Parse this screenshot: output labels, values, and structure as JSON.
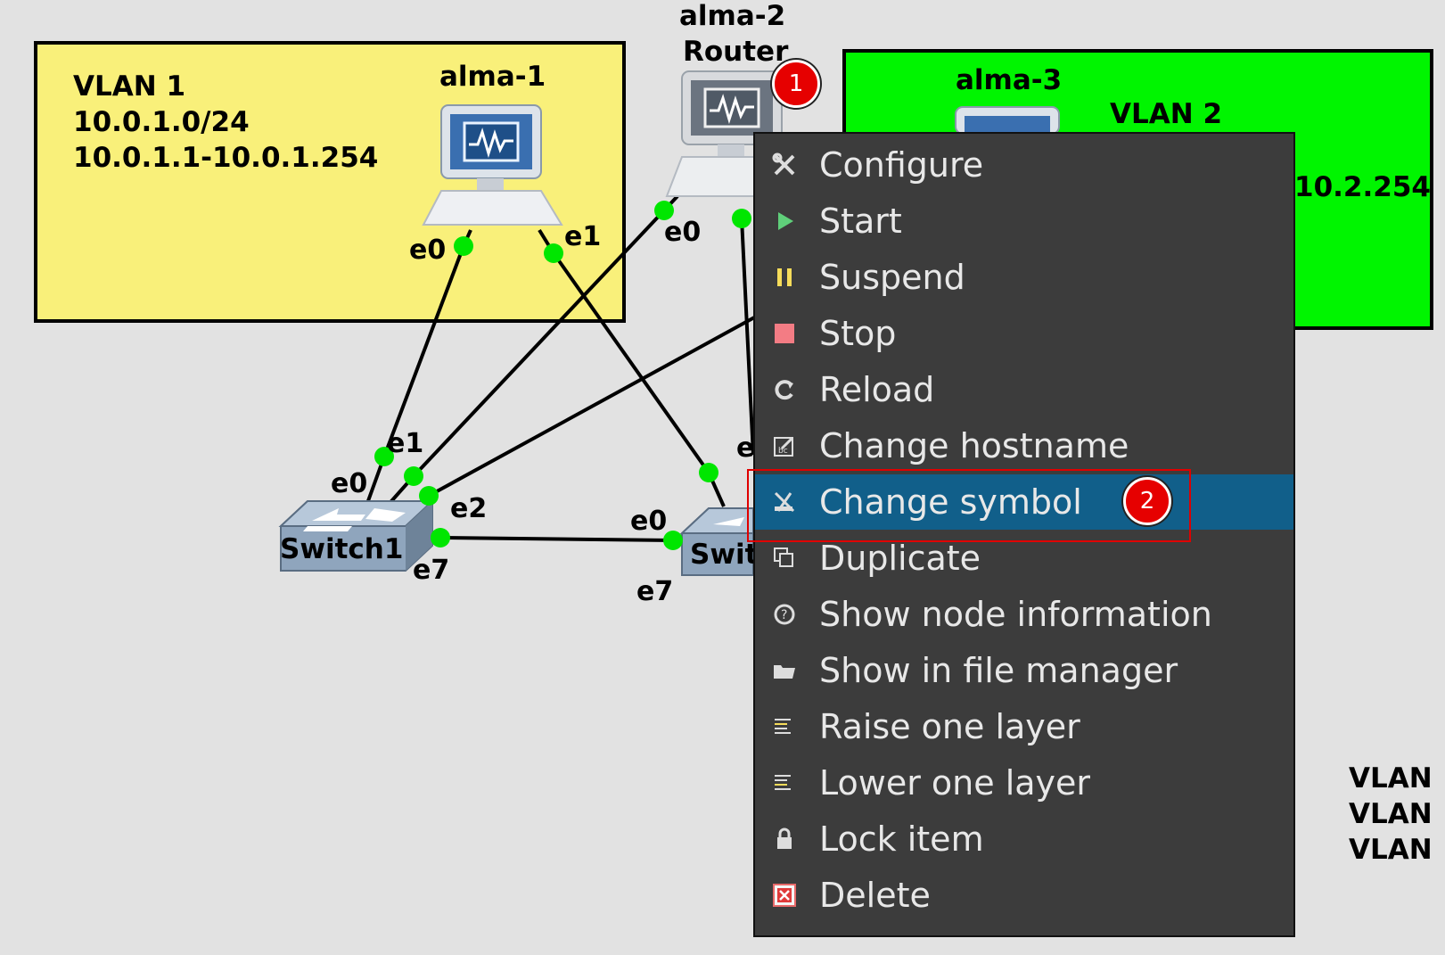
{
  "vlan1": {
    "lines": [
      "VLAN 1",
      "10.0.1.0/24",
      "10.0.1.1-10.0.1.254"
    ],
    "color": "#f9f07a"
  },
  "vlan2": {
    "title": "VLAN 2",
    "range_fragment": "10.2.254",
    "color": "#00f500"
  },
  "nodes": {
    "alma1": {
      "label": "alma-1",
      "ports": [
        "e0",
        "e1"
      ]
    },
    "alma2": {
      "label": "alma-2",
      "sublabel": "Router",
      "ports": [
        "e0"
      ]
    },
    "alma3": {
      "label": "alma-3"
    },
    "switch1": {
      "label": "Switch1",
      "ports": [
        "e1",
        "e0",
        "e2",
        "e7"
      ]
    },
    "switch2": {
      "label": "Swit",
      "ports": [
        "e0",
        "e7",
        "e"
      ]
    }
  },
  "badges": {
    "badge1": "1",
    "badge2": "2"
  },
  "legend_fragment": [
    "VLAN",
    "VLAN",
    "VLAN"
  ],
  "context_menu": {
    "items": [
      {
        "label": "Configure",
        "icon": "configure-icon"
      },
      {
        "label": "Start",
        "icon": "start-icon"
      },
      {
        "label": "Suspend",
        "icon": "suspend-icon"
      },
      {
        "label": "Stop",
        "icon": "stop-icon"
      },
      {
        "label": "Reload",
        "icon": "reload-icon"
      },
      {
        "label": "Change hostname",
        "icon": "change-hostname-icon"
      },
      {
        "label": "Change symbol",
        "icon": "change-symbol-icon",
        "selected": true
      },
      {
        "label": "Duplicate",
        "icon": "duplicate-icon"
      },
      {
        "label": "Show node information",
        "icon": "info-icon"
      },
      {
        "label": "Show in file manager",
        "icon": "folder-icon"
      },
      {
        "label": "Raise one layer",
        "icon": "raise-layer-icon"
      },
      {
        "label": "Lower one layer",
        "icon": "lower-layer-icon"
      },
      {
        "label": "Lock item",
        "icon": "lock-icon"
      },
      {
        "label": "Delete",
        "icon": "delete-icon"
      }
    ]
  },
  "colors": {
    "port_dot": "#00e600",
    "menu_bg": "#3c3c3c",
    "menu_selected": "#115f8a",
    "badge": "#e60000"
  }
}
